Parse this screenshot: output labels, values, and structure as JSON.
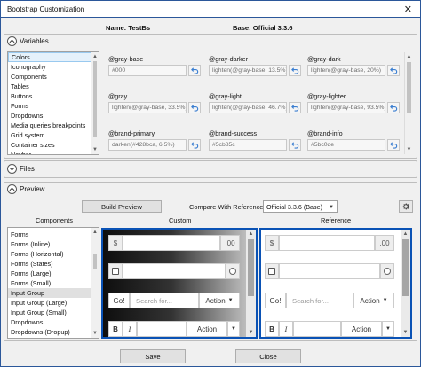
{
  "window": {
    "title": "Bootstrap Customization"
  },
  "header": {
    "name": "Name: TestBs",
    "base": "Base: Official 3.3.6"
  },
  "variables_section": {
    "title": "Variables",
    "categories": [
      "Colors",
      "Iconography",
      "Components",
      "Tables",
      "Buttons",
      "Forms",
      "Dropdowns",
      "Media queries breakpoints",
      "Grid system",
      "Container sizes",
      "Navbar"
    ],
    "selected_index": 0,
    "vars": [
      {
        "name": "@gray-base",
        "value": "#000"
      },
      {
        "name": "@gray-darker",
        "value": "lighten(@gray-base, 13.5%)"
      },
      {
        "name": "@gray-dark",
        "value": "lighten(@gray-base, 20%)"
      },
      {
        "name": "@gray",
        "value": "lighten(@gray-base, 33.5%)"
      },
      {
        "name": "@gray-light",
        "value": "lighten(@gray-base, 46.7%)"
      },
      {
        "name": "@gray-lighter",
        "value": "lighten(@gray-base, 93.5%)"
      },
      {
        "name": "@brand-primary",
        "value": "darken(#428bca, 6.5%)"
      },
      {
        "name": "@brand-success",
        "value": "#5cb85c"
      },
      {
        "name": "@brand-info",
        "value": "#5bc0de"
      }
    ]
  },
  "files_section": {
    "title": "Files"
  },
  "preview_section": {
    "title": "Preview",
    "build_button": "Build Preview",
    "compare_label": "Compare With Reference:",
    "compare_value": "Official 3.3.6 (Base)",
    "components_header": "Components",
    "custom_header": "Custom",
    "reference_header": "Reference",
    "components": [
      "Forms",
      "Forms (Inline)",
      "Forms (Horizontal)",
      "Forms (States)",
      "Forms (Large)",
      "Forms (Small)",
      "Input Group",
      "Input Group (Large)",
      "Input Group (Small)",
      "Dropdowns",
      "Dropdowns (Dropup)"
    ],
    "selected_component": 6,
    "demo": {
      "addon_dollar": "$",
      "addon_cents": ".00",
      "go_button": "Go!",
      "search_placeholder": "Search for...",
      "action_button": "Action",
      "bold_button": "B",
      "italic_button": "I"
    }
  },
  "footer": {
    "save": "Save",
    "close": "Close"
  },
  "colors": {
    "accent_border": "#0a52b5",
    "undo_icon": "#3c7fd1"
  }
}
